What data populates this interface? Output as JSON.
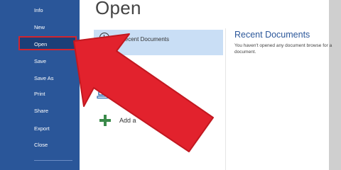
{
  "sidebar": {
    "items": [
      {
        "label": "Info"
      },
      {
        "label": "New"
      },
      {
        "label": "Open"
      },
      {
        "label": "Save"
      },
      {
        "label": "Save As"
      },
      {
        "label": "Print"
      },
      {
        "label": "Share"
      },
      {
        "label": "Export"
      },
      {
        "label": "Close"
      }
    ]
  },
  "main": {
    "title": "Open",
    "places": {
      "recent_label": "Recent Documents",
      "add_label": "Add a"
    },
    "recent": {
      "title": "Recent Documents",
      "text": "You haven't opened any document browse for a document."
    }
  },
  "annotation": {
    "arrow_color": "#e2222d",
    "outline_color": "#c21820"
  },
  "colors": {
    "sidebar": "#2a5699",
    "highlight": "#c9def5",
    "accent": "#2b579a"
  }
}
